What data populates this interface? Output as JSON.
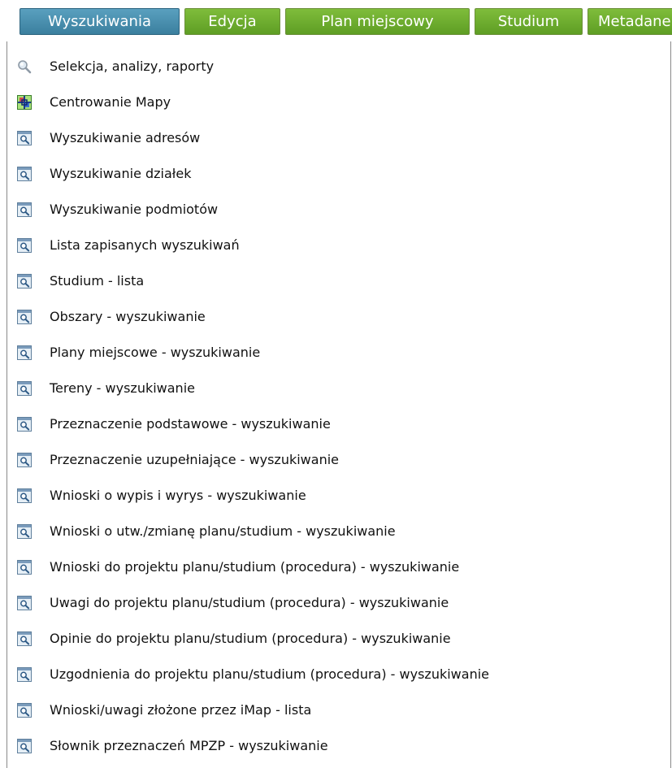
{
  "tabs": [
    {
      "label": "Wyszukiwania",
      "active": true
    },
    {
      "label": "Edycja",
      "active": false
    },
    {
      "label": "Plan miejscowy",
      "active": false
    },
    {
      "label": "Studium",
      "active": false
    },
    {
      "label": "Metadane",
      "active": false
    }
  ],
  "menu": {
    "items": [
      {
        "label": "Selekcja, analizy, raporty",
        "icon": "magnifier-icon"
      },
      {
        "label": "Centrowanie Mapy",
        "icon": "map-center-icon"
      },
      {
        "label": "Wyszukiwanie adresów",
        "icon": "search-window-icon"
      },
      {
        "label": "Wyszukiwanie działek",
        "icon": "search-window-icon"
      },
      {
        "label": "Wyszukiwanie podmiotów",
        "icon": "search-window-icon"
      },
      {
        "label": "Lista zapisanych wyszukiwań",
        "icon": "search-window-icon"
      },
      {
        "label": "Studium - lista",
        "icon": "search-window-icon"
      },
      {
        "label": "Obszary - wyszukiwanie",
        "icon": "search-window-icon"
      },
      {
        "label": "Plany miejscowe - wyszukiwanie",
        "icon": "search-window-icon"
      },
      {
        "label": "Tereny - wyszukiwanie",
        "icon": "search-window-icon"
      },
      {
        "label": "Przeznaczenie podstawowe - wyszukiwanie",
        "icon": "search-window-icon"
      },
      {
        "label": "Przeznaczenie uzupełniające - wyszukiwanie",
        "icon": "search-window-icon"
      },
      {
        "label": "Wnioski o wypis i wyrys - wyszukiwanie",
        "icon": "search-window-icon"
      },
      {
        "label": "Wnioski o utw./zmianę planu/studium - wyszukiwanie",
        "icon": "search-window-icon"
      },
      {
        "label": "Wnioski do projektu planu/studium (procedura) - wyszukiwanie",
        "icon": "search-window-icon"
      },
      {
        "label": "Uwagi do projektu planu/studium (procedura) - wyszukiwanie",
        "icon": "search-window-icon"
      },
      {
        "label": "Opinie do projektu planu/studium (procedura) - wyszukiwanie",
        "icon": "search-window-icon"
      },
      {
        "label": "Uzgodnienia do projektu planu/studium (procedura) - wyszukiwanie",
        "icon": "search-window-icon"
      },
      {
        "label": "Wnioski/uwagi złożone przez iMap - lista",
        "icon": "search-window-icon"
      },
      {
        "label": "Słownik przeznaczeń MPZP - wyszukiwanie",
        "icon": "search-window-icon"
      }
    ]
  },
  "colors": {
    "tab_active": "#3b7f9e",
    "tab_inactive": "#5e9e24",
    "menu_border": "#8a8a8a"
  }
}
